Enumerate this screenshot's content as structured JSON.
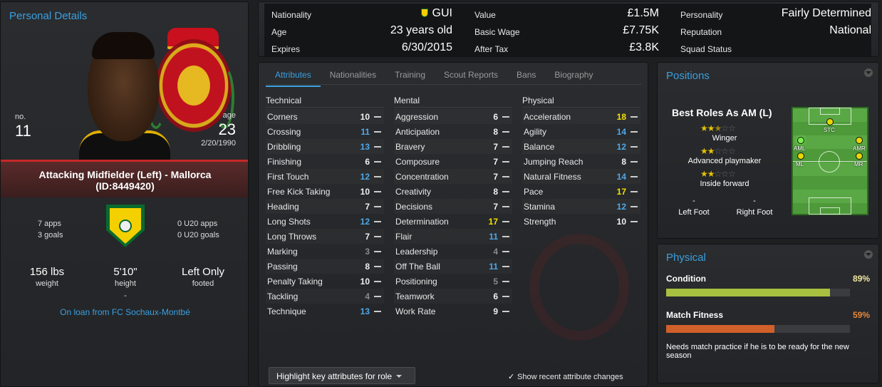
{
  "left": {
    "title": "Personal Details",
    "number_label": "no.",
    "number": "11",
    "age_label": "age",
    "age": "23",
    "dob": "2/20/1990",
    "role_line1": "Attacking Midfielder (Left) - Mallorca",
    "role_line2": "(ID:8449420)",
    "apps": "7 apps",
    "goals": "3 goals",
    "u20_apps": "0 U20 apps",
    "u20_goals": "0 U20 goals",
    "weight": "156 lbs",
    "weight_label": "weight",
    "height": "5'10\"",
    "height_label": "height",
    "height_sub": "-",
    "foot": "Left Only",
    "foot_label": "footed",
    "loan": "On loan from FC Sochaux-Montbé"
  },
  "info": {
    "nationality_label": "Nationality",
    "nationality": "GUI",
    "age_label": "Age",
    "age": "23 years old",
    "expires_label": "Expires",
    "expires": "6/30/2015",
    "value_label": "Value",
    "value": "£1.5M",
    "wage_label": "Basic Wage",
    "wage": "£7.75K",
    "tax_label": "After Tax",
    "tax": "£3.8K",
    "personality_label": "Personality",
    "personality": "Fairly Determined",
    "reputation_label": "Reputation",
    "reputation": "National",
    "squad_label": "Squad Status"
  },
  "tabs": [
    "Attributes",
    "Nationalities",
    "Training",
    "Scout Reports",
    "Bans",
    "Biography"
  ],
  "attributes": {
    "technical_title": "Technical",
    "mental_title": "Mental",
    "physical_title": "Physical",
    "technical": [
      {
        "name": "Corners",
        "value": "10",
        "color": "white"
      },
      {
        "name": "Crossing",
        "value": "11",
        "color": "blue"
      },
      {
        "name": "Dribbling",
        "value": "13",
        "color": "blue"
      },
      {
        "name": "Finishing",
        "value": "6",
        "color": "white"
      },
      {
        "name": "First Touch",
        "value": "12",
        "color": "blue"
      },
      {
        "name": "Free Kick Taking",
        "value": "10",
        "color": "white"
      },
      {
        "name": "Heading",
        "value": "7",
        "color": "white"
      },
      {
        "name": "Long Shots",
        "value": "12",
        "color": "blue"
      },
      {
        "name": "Long Throws",
        "value": "7",
        "color": "white"
      },
      {
        "name": "Marking",
        "value": "3",
        "color": "grey"
      },
      {
        "name": "Passing",
        "value": "8",
        "color": "white"
      },
      {
        "name": "Penalty Taking",
        "value": "10",
        "color": "white"
      },
      {
        "name": "Tackling",
        "value": "4",
        "color": "grey"
      },
      {
        "name": "Technique",
        "value": "13",
        "color": "blue"
      }
    ],
    "mental": [
      {
        "name": "Aggression",
        "value": "6",
        "color": "white"
      },
      {
        "name": "Anticipation",
        "value": "8",
        "color": "white"
      },
      {
        "name": "Bravery",
        "value": "7",
        "color": "white"
      },
      {
        "name": "Composure",
        "value": "7",
        "color": "white"
      },
      {
        "name": "Concentration",
        "value": "7",
        "color": "white"
      },
      {
        "name": "Creativity",
        "value": "8",
        "color": "white"
      },
      {
        "name": "Decisions",
        "value": "7",
        "color": "white"
      },
      {
        "name": "Determination",
        "value": "17",
        "color": "yellow"
      },
      {
        "name": "Flair",
        "value": "11",
        "color": "blue"
      },
      {
        "name": "Leadership",
        "value": "4",
        "color": "grey"
      },
      {
        "name": "Off The Ball",
        "value": "11",
        "color": "blue"
      },
      {
        "name": "Positioning",
        "value": "5",
        "color": "grey"
      },
      {
        "name": "Teamwork",
        "value": "6",
        "color": "white"
      },
      {
        "name": "Work Rate",
        "value": "9",
        "color": "white"
      }
    ],
    "physical": [
      {
        "name": "Acceleration",
        "value": "18",
        "color": "yellow"
      },
      {
        "name": "Agility",
        "value": "14",
        "color": "blue"
      },
      {
        "name": "Balance",
        "value": "12",
        "color": "blue"
      },
      {
        "name": "Jumping Reach",
        "value": "8",
        "color": "white"
      },
      {
        "name": "Natural Fitness",
        "value": "14",
        "color": "blue"
      },
      {
        "name": "Pace",
        "value": "17",
        "color": "yellow"
      },
      {
        "name": "Stamina",
        "value": "12",
        "color": "blue"
      },
      {
        "name": "Strength",
        "value": "10",
        "color": "white"
      }
    ],
    "highlight_button": "Highlight key attributes for role",
    "show_recent": "Show recent attribute changes"
  },
  "positions": {
    "title": "Positions",
    "best_roles": "Best Roles As AM (L)",
    "roles": [
      {
        "name": "Winger",
        "stars": 2.5
      },
      {
        "name": "Advanced playmaker",
        "stars": 2
      },
      {
        "name": "Inside forward",
        "stars": 2
      }
    ],
    "left_foot_dash": "-",
    "left_foot": "Left Foot",
    "right_foot_dash": "-",
    "right_foot": "Right Foot",
    "pitch_labels": [
      "STC",
      "AML",
      "AMR",
      "ML",
      "MR"
    ]
  },
  "physical": {
    "title": "Physical",
    "condition_label": "Condition",
    "condition": "89%",
    "condition_fraction": 0.89,
    "fitness_label": "Match Fitness",
    "fitness": "59%",
    "fitness_fraction": 0.59,
    "note": "Needs match practice if he is to be ready for the new season",
    "colors": {
      "condition": "#a8c040",
      "fitness": "#d0602a",
      "condition_text": "#f0e8a0",
      "fitness_text": "#e8883a"
    }
  }
}
